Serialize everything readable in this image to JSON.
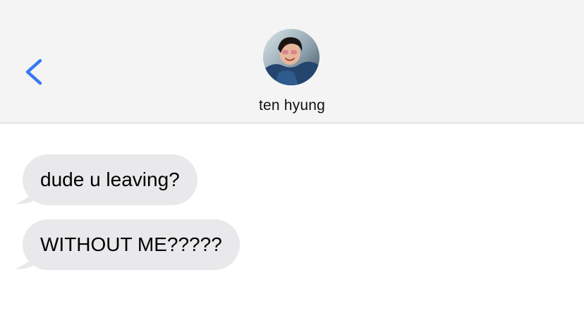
{
  "header": {
    "back_icon": "chevron-left-icon",
    "avatar_icon": "contact-avatar-photo",
    "contact_name": "ten hyung"
  },
  "messages": [
    {
      "direction": "incoming",
      "text": "dude u leaving?"
    },
    {
      "direction": "incoming",
      "text": "WITHOUT ME?????"
    }
  ],
  "colors": {
    "header_background": "#f4f4f5",
    "accent_blue": "#3478f6",
    "incoming_bubble": "#e9e9eb",
    "text": "#000000"
  }
}
